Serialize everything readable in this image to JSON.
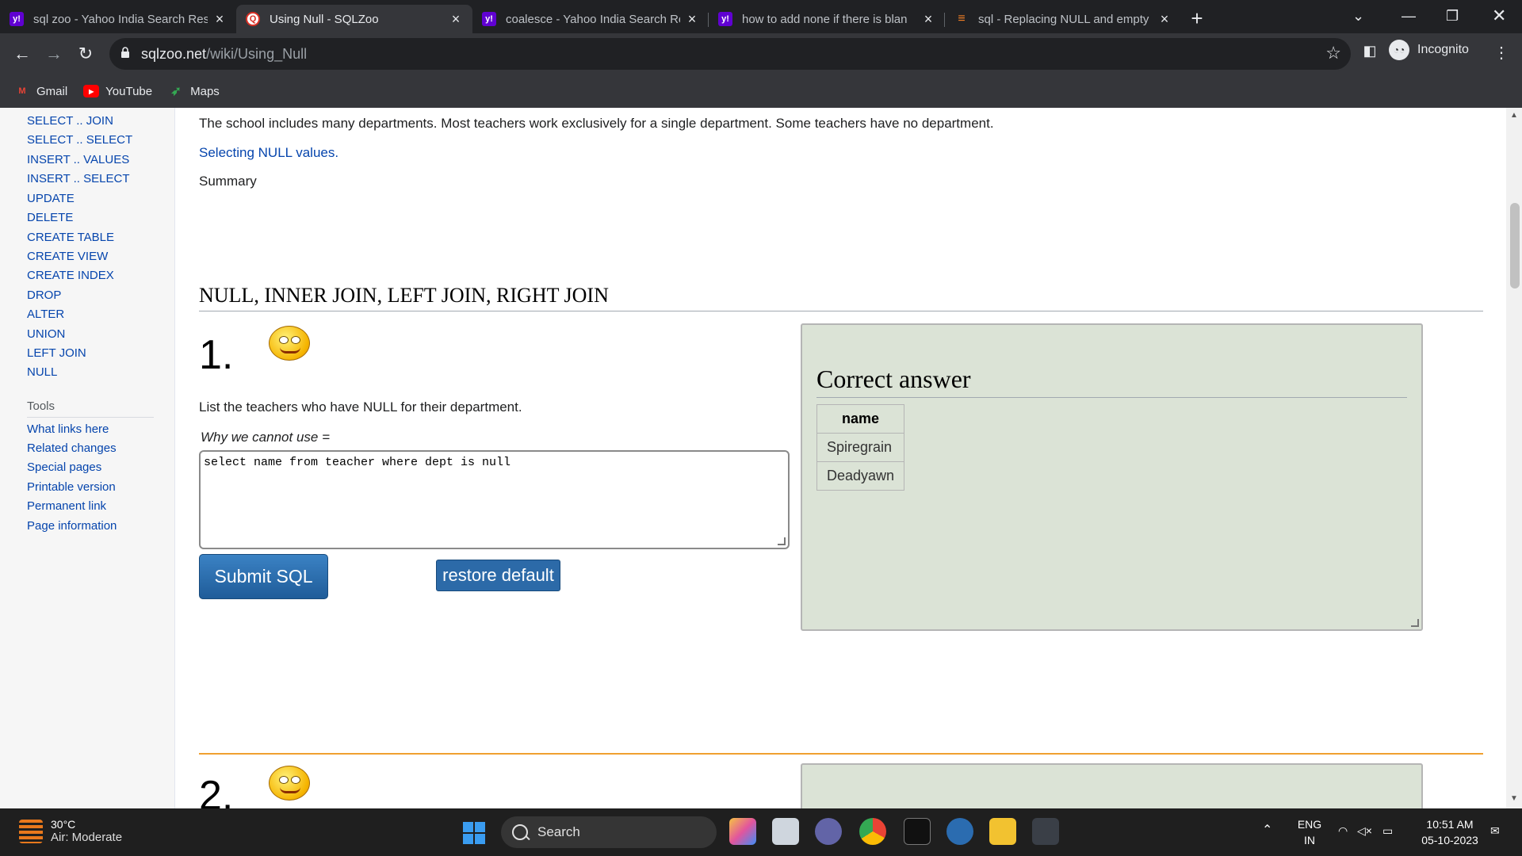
{
  "browser": {
    "tabs": [
      {
        "title": "sql zoo - Yahoo India Search Res",
        "icon": "yahoo-icon",
        "active": false
      },
      {
        "title": "Using Null - SQLZoo",
        "icon": "sqlzoo-icon",
        "active": true
      },
      {
        "title": "coalesce - Yahoo India Search Re",
        "icon": "yahoo-icon",
        "active": false
      },
      {
        "title": "how to add none if there is blan",
        "icon": "yahoo-icon",
        "active": false
      },
      {
        "title": "sql - Replacing NULL and empty",
        "icon": "stackoverflow-icon",
        "active": false
      }
    ],
    "url_host": "sqlzoo.net",
    "url_path": "/wiki/Using_Null",
    "profile_label": "Incognito",
    "bookmarks": [
      {
        "label": "Gmail",
        "icon": "gmail-icon"
      },
      {
        "label": "YouTube",
        "icon": "youtube-icon"
      },
      {
        "label": "Maps",
        "icon": "maps-icon"
      }
    ]
  },
  "sidebar": {
    "links": [
      "SELECT .. JOIN",
      "SELECT .. SELECT",
      "INSERT .. VALUES",
      "INSERT .. SELECT",
      "UPDATE",
      "DELETE",
      "CREATE TABLE",
      "CREATE VIEW",
      "CREATE INDEX",
      "DROP",
      "ALTER",
      "UNION",
      "LEFT JOIN",
      "NULL"
    ],
    "tools_heading": "Tools",
    "tools": [
      "What links here",
      "Related changes",
      "Special pages",
      "Printable version",
      "Permanent link",
      "Page information"
    ]
  },
  "content": {
    "intro": "The school includes many departments. Most teachers work exclusively for a single department. Some teachers have no department.",
    "selecting_link": "Selecting NULL values.",
    "summary": "Summary",
    "section_heading": "NULL, INNER JOIN, LEFT JOIN, RIGHT JOIN",
    "q1_number": "1.",
    "q1_text": "List the teachers who have NULL for their department.",
    "q1_hint": "Why we cannot use =",
    "q1_sql": "select name from teacher where dept is null",
    "submit_label": "Submit SQL",
    "restore_label": "restore default",
    "answer_heading": "Correct answer",
    "answer_table": {
      "header": "name",
      "rows": [
        "Spiregrain",
        "Deadyawn"
      ]
    },
    "q2_number": "2."
  },
  "taskbar": {
    "temperature": "30°C",
    "air_quality": "Air: Moderate",
    "search_label": "Search",
    "lang_line1": "ENG",
    "lang_line2": "IN",
    "time": "10:51 AM",
    "date": "05-10-2023"
  }
}
